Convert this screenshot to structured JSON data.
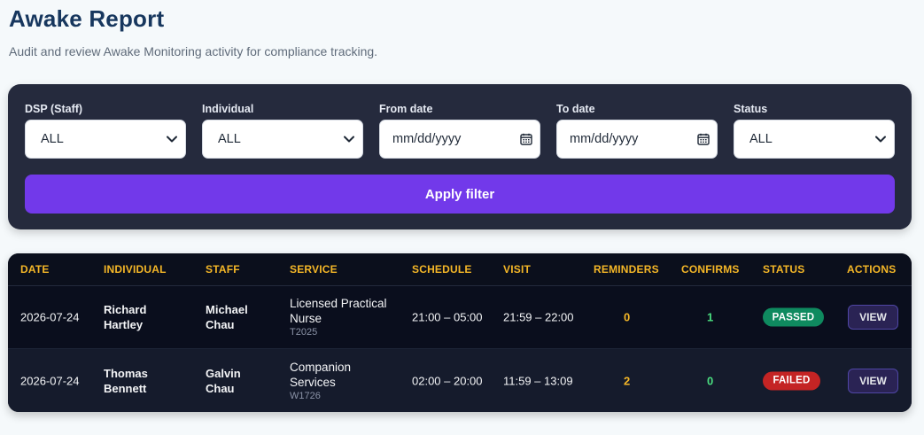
{
  "page": {
    "title": "Awake Report",
    "subtitle": "Audit and review Awake Monitoring activity for compliance tracking."
  },
  "filters": {
    "dsp": {
      "label": "DSP (Staff)",
      "value": "ALL"
    },
    "individual": {
      "label": "Individual",
      "value": "ALL"
    },
    "from_date": {
      "label": "From date",
      "value": "mm/dd/yyyy"
    },
    "to_date": {
      "label": "To date",
      "value": "mm/dd/yyyy"
    },
    "status": {
      "label": "Status",
      "value": "ALL"
    },
    "apply_label": "Apply filter"
  },
  "table": {
    "columns": [
      "DATE",
      "INDIVIDUAL",
      "STAFF",
      "SERVICE",
      "SCHEDULE",
      "VISIT",
      "REMINDERS",
      "CONFIRMS",
      "STATUS",
      "ACTIONS"
    ],
    "rows": [
      {
        "date": "2026-07-24",
        "individual_first": "Richard",
        "individual_last": "Hartley",
        "staff_first": "Michael",
        "staff_last": "Chau",
        "service_line1": "Licensed Practical",
        "service_line2": "Nurse",
        "service_code": "T2025",
        "schedule": "21:00 – 05:00",
        "visit": "21:59 – 22:00",
        "reminders": "0",
        "confirms": "1",
        "status": "PASSED",
        "action": "VIEW"
      },
      {
        "date": "2026-07-24",
        "individual_first": "Thomas",
        "individual_last": "Bennett",
        "staff_first": "Galvin",
        "staff_last": "Chau",
        "service_line1": "Companion",
        "service_line2": "Services",
        "service_code": "W1726",
        "schedule": "02:00 – 20:00",
        "visit": "11:59 – 13:09",
        "reminders": "2",
        "confirms": "0",
        "status": "FAILED",
        "action": "VIEW"
      }
    ]
  },
  "colors": {
    "accent": "#7239ea",
    "header_text": "#f5b727",
    "passed": "#0f8a5f",
    "failed": "#c42424"
  }
}
